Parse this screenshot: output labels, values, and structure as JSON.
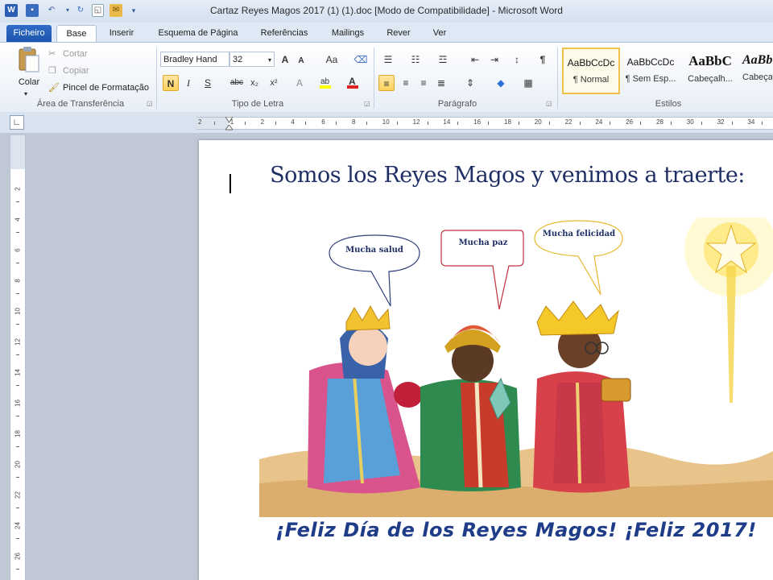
{
  "window": {
    "title": "Cartaz Reyes Magos 2017 (1) (1).doc [Modo de Compatibilidade] - Microsoft Word",
    "app_icon": "W"
  },
  "tabs": [
    {
      "label": "Ficheiro"
    },
    {
      "label": "Base"
    },
    {
      "label": "Inserir"
    },
    {
      "label": "Esquema de Página"
    },
    {
      "label": "Referências"
    },
    {
      "label": "Mailings"
    },
    {
      "label": "Rever"
    },
    {
      "label": "Ver"
    }
  ],
  "clipboard": {
    "paste": "Colar",
    "cut": "Cortar",
    "copy": "Copiar",
    "format_painter": "Pincel de Formatação",
    "group": "Área de Transferência"
  },
  "font": {
    "name": "Bradley Hand",
    "size": "32",
    "group": "Tipo de Letra",
    "bold": "N",
    "italic": "I",
    "underline": "S",
    "strike": "abc",
    "subscript": "x₂",
    "superscript": "x²",
    "grow": "A",
    "shrink": "A",
    "case": "Aa"
  },
  "paragraph": {
    "group": "Parágrafo",
    "pilcrow": "¶"
  },
  "styles": {
    "group": "Estilos",
    "items": [
      {
        "preview": "AaBbCcDc",
        "name": "¶ Normal"
      },
      {
        "preview": "AaBbCcDc",
        "name": "¶ Sem Esp..."
      },
      {
        "preview": "AaBbC",
        "name": "Cabeçalh..."
      },
      {
        "preview": "AaBb",
        "name": "Cabeça"
      }
    ]
  },
  "ruler": {
    "h_numbers": [
      "2",
      "1",
      "2",
      "4",
      "6",
      "8",
      "10",
      "12",
      "14",
      "16",
      "18",
      "20",
      "22",
      "24",
      "26",
      "28",
      "30",
      "32",
      "34"
    ],
    "v_numbers": [
      "2",
      "4",
      "6",
      "8",
      "10",
      "12",
      "14",
      "16",
      "18",
      "20",
      "22",
      "24",
      "26"
    ]
  },
  "document": {
    "heading": "Somos los Reyes Magos y venimos a traerte:",
    "bubbles": [
      "Mucha salud",
      "Mucha paz",
      "Mucha felicidad"
    ],
    "footer": "¡Feliz Día de los Reyes Magos! ¡Feliz 2017!"
  },
  "colors": {
    "accent": "#2b579a",
    "heading": "#1f2f66",
    "footer": "#1f3c88"
  }
}
